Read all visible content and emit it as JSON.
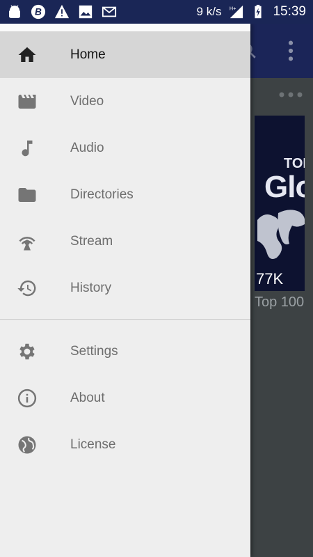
{
  "status_bar": {
    "speed": "9 k/s",
    "time": "15:39",
    "network": "H+",
    "notification_icons": [
      "android-icon",
      "b-app-icon",
      "warning-icon",
      "image-icon",
      "mail-icon"
    ]
  },
  "background": {
    "thumbnail_title_top": "TOP",
    "thumbnail_title_main": "Glo",
    "thumbnail_count": "77K",
    "caption": "Top 100"
  },
  "drawer": {
    "primary_items": [
      {
        "label": "Home",
        "icon": "home-icon",
        "active": true
      },
      {
        "label": "Video",
        "icon": "movie-icon",
        "active": false
      },
      {
        "label": "Audio",
        "icon": "music-note-icon",
        "active": false
      },
      {
        "label": "Directories",
        "icon": "folder-icon",
        "active": false
      },
      {
        "label": "Stream",
        "icon": "antenna-icon",
        "active": false
      },
      {
        "label": "History",
        "icon": "history-icon",
        "active": false
      }
    ],
    "secondary_items": [
      {
        "label": "Settings",
        "icon": "gear-icon"
      },
      {
        "label": "About",
        "icon": "info-icon"
      },
      {
        "label": "License",
        "icon": "globe-icon"
      }
    ]
  },
  "colors": {
    "primary_dark": "#1a2656",
    "primary": "#1b2558",
    "drawer_bg": "#eeeeee",
    "active_item_bg": "#d6d6d6",
    "icon_grey": "#757575"
  }
}
